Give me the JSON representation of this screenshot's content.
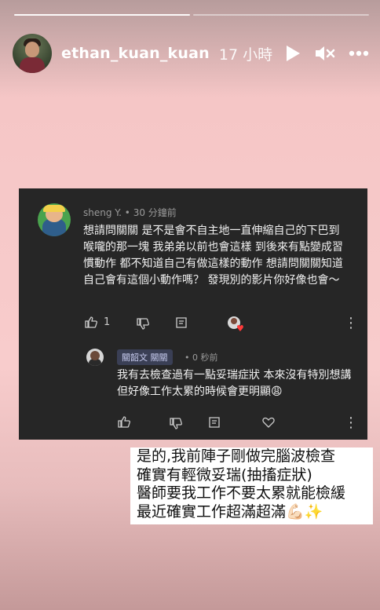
{
  "story": {
    "segments_total": 2,
    "segments_done": 1,
    "username": "ethan_kuan_kuan",
    "time_ago": "17 小時",
    "icons": [
      "play-icon",
      "mute-icon",
      "more-icon"
    ]
  },
  "comment": {
    "author": "sheng Y.",
    "time": "30 分鐘前",
    "meta_line": "sheng Y. • 30 分鐘前",
    "text": "想請問關關 是不是會不自主地一直伸縮自己的下巴到喉嚨的那一塊 我弟弟以前也會這樣 到後來有點變成習慣動作 都不知道自己有做這樣的動作 想請問關關知道自己會有這個小動作嗎？ 發現別的影片你好像也會～",
    "like_count": "1"
  },
  "reply": {
    "author_badge": "關韶文 關關",
    "time": "• 0 秒前",
    "text": "我有去檢查過有一點妥瑞症狀 本來沒有特別想講 但好像工作太累的時候會更明顯😩"
  },
  "caption": {
    "lines": [
      "是的,我前陣子剛做完腦波檢查",
      "確實有輕微妥瑞(抽搐症狀)",
      "醫師要我工作不要太累就能檢緩",
      "最近確實工作超滿超滿💪🏻✨"
    ]
  },
  "colors": {
    "card_bg": "#262626",
    "badge_bg": "#3a3f55",
    "heart": "#ff3b3b"
  }
}
